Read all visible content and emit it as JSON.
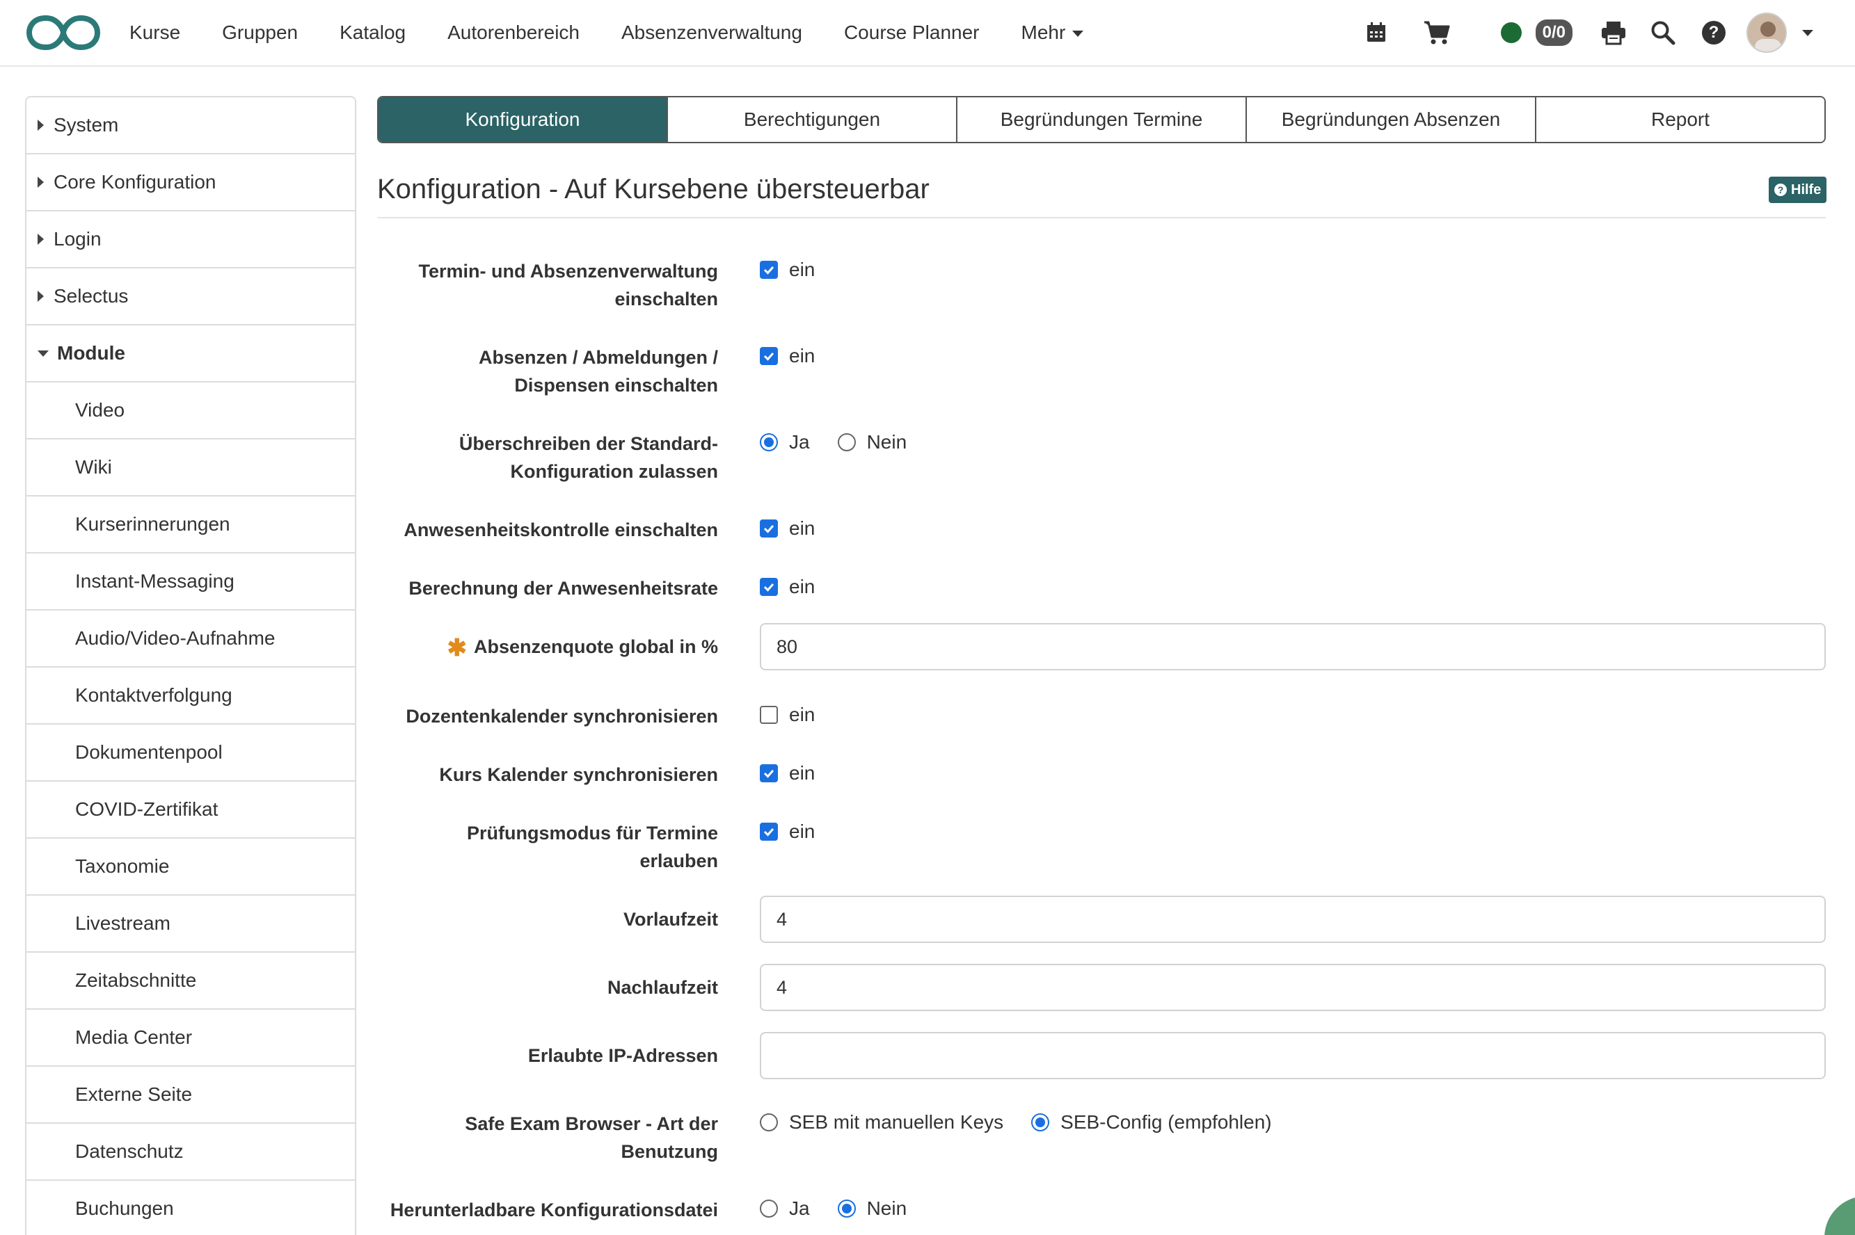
{
  "nav": {
    "items": [
      "Kurse",
      "Gruppen",
      "Katalog",
      "Autorenbereich",
      "Absenzenverwaltung",
      "Course Planner"
    ],
    "more_label": "Mehr"
  },
  "toolbar": {
    "counter": "0/0",
    "icons": [
      "calendar-icon",
      "cart-icon",
      "status-icon",
      "print-icon",
      "search-icon",
      "help-icon",
      "avatar",
      "chevron-down-icon"
    ],
    "status_color": "#1d6b34"
  },
  "sidebar": {
    "top_items": [
      "System",
      "Core Konfiguration",
      "Login",
      "Selectus"
    ],
    "open_item": "Module",
    "sub_items": [
      "Video",
      "Wiki",
      "Kurserinnerungen",
      "Instant-Messaging",
      "Audio/Video-Aufnahme",
      "Kontaktverfolgung",
      "Dokumentenpool",
      "COVID-Zertifikat",
      "Taxonomie",
      "Livestream",
      "Zeitabschnitte",
      "Media Center",
      "Externe Seite",
      "Datenschutz",
      "Buchungen"
    ]
  },
  "tabs": {
    "items": [
      "Konfiguration",
      "Berechtigungen",
      "Begründungen Termine",
      "Begründungen Absenzen",
      "Report"
    ],
    "active": "Konfiguration"
  },
  "page": {
    "title": "Konfiguration - Auf Kursebene übersteuerbar",
    "help_label": "Hilfe",
    "accent_color": "#2b6366"
  },
  "form": {
    "on_label": "ein",
    "yes_label": "Ja",
    "no_label": "Nein",
    "f1": {
      "label_line1": "Termin- und Absenzenverwaltung",
      "label_line2": "einschalten",
      "checked": true
    },
    "f2": {
      "label_line1": "Absenzen / Abmeldungen /",
      "label_line2": "Dispensen einschalten",
      "checked": true
    },
    "f3": {
      "label_line1": "Überschreiben der Standard-",
      "label_line2": "Konfiguration zulassen",
      "selected": "Ja"
    },
    "f4": {
      "label": "Anwesenheitskontrolle einschalten",
      "checked": true
    },
    "f5": {
      "label": "Berechnung der Anwesenheitsrate",
      "checked": true
    },
    "f6": {
      "label": "Absenzenquote global in %",
      "value": "80",
      "required": true
    },
    "f7": {
      "label": "Dozentenkalender synchronisieren",
      "checked": false
    },
    "f8": {
      "label": "Kurs Kalender synchronisieren",
      "checked": true
    },
    "f9": {
      "label_line1": "Prüfungsmodus für Termine",
      "label_line2": "erlauben",
      "checked": true
    },
    "f10": {
      "label": "Vorlaufzeit",
      "value": "4"
    },
    "f11": {
      "label": "Nachlaufzeit",
      "value": "4"
    },
    "f12": {
      "label": "Erlaubte IP-Adressen",
      "value": ""
    },
    "f13": {
      "label_line1": "Safe Exam Browser - Art der",
      "label_line2": "Benutzung",
      "option_a": "SEB mit manuellen Keys",
      "option_b": "SEB-Config (empfohlen)",
      "selected": "SEB-Config (empfohlen)"
    },
    "f14": {
      "label": "Herunterladbare Konfigurationsdatei",
      "selected": "Nein"
    }
  }
}
